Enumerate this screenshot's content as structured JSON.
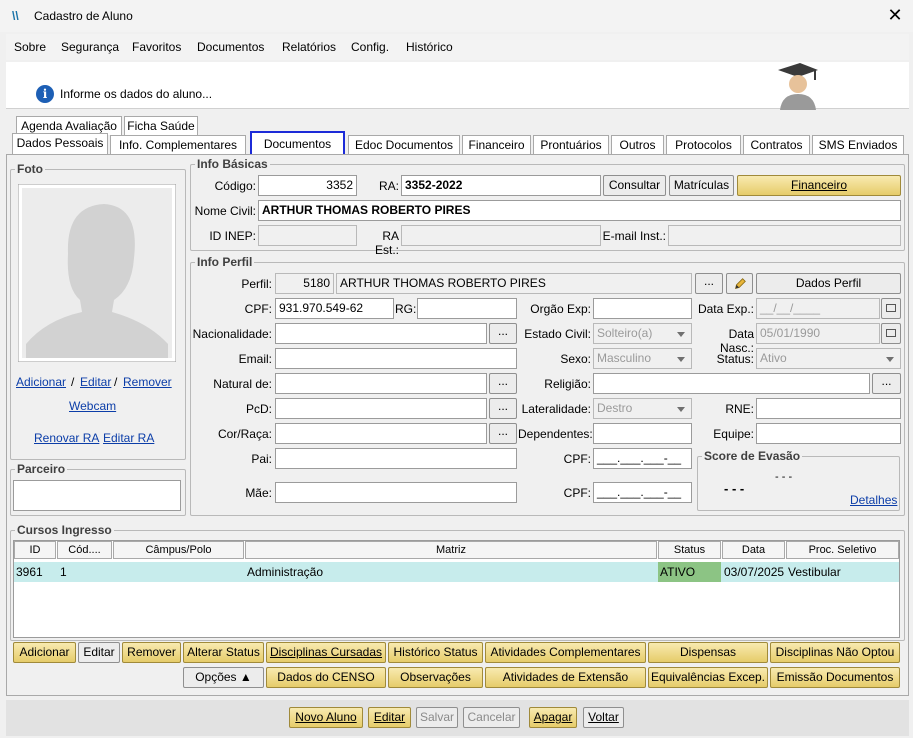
{
  "window": {
    "logo": "\\\\",
    "title": "Cadastro de Aluno",
    "close": "✕"
  },
  "menu": [
    "Sobre",
    "Segurança",
    "Favoritos",
    "Documentos",
    "Relatórios",
    "Config.",
    "Histórico"
  ],
  "info": {
    "text": "Informe os dados do aluno..."
  },
  "tabs_row1": [
    "Agenda Avaliação",
    "Ficha Saúde"
  ],
  "tabs_row2": [
    "Dados Pessoais",
    "Info. Complementares",
    "Documentos",
    "Edoc Documentos",
    "Financeiro",
    "Prontuários",
    "Outros",
    "Protocolos",
    "Contratos",
    "SMS Enviados"
  ],
  "foto": {
    "legend": "Foto",
    "adicionar": "Adicionar",
    "sep": "/",
    "editar": "Editar",
    "remover": "Remover",
    "webcam": "Webcam",
    "renovar_ra": "Renovar RA",
    "editar_ra": "Editar RA"
  },
  "parceiro": {
    "legend": "Parceiro"
  },
  "info_basicas": {
    "legend": "Info Básicas",
    "codigo_label": "Código:",
    "codigo": "3352",
    "ra_label": "RA:",
    "ra": "3352-2022",
    "consultar": "Consultar",
    "matriculas": "Matrículas",
    "financeiro": "Financeiro",
    "nome_label": "Nome Civil:",
    "nome": "ARTHUR THOMAS ROBERTO PIRES",
    "inep_label": "ID INEP:",
    "ra_est_label": "RA Est.:",
    "email_inst_label": "E-mail Inst.:"
  },
  "info_perfil": {
    "legend": "Info Perfil",
    "perfil_label": "Perfil:",
    "perfil_id": "5180",
    "perfil_nome": "ARTHUR THOMAS ROBERTO PIRES",
    "dots": "...",
    "dados_perfil": "Dados Perfil",
    "cpf_label": "CPF:",
    "cpf": "931.970.549-62",
    "rg_label": "RG:",
    "orgao_label": "Orgão Exp:",
    "data_exp_label": "Data Exp.:",
    "data_exp": "__/__/____",
    "nacionalidade_label": "Nacionalidade:",
    "estado_civil_label": "Estado Civil:",
    "estado_civil": "Solteiro(a)",
    "data_nasc_label": "Data Nasc.:",
    "data_nasc": "05/01/1990",
    "email_label": "Email:",
    "sexo_label": "Sexo:",
    "sexo": "Masculino",
    "status_label": "Status:",
    "status": "Ativo",
    "natural_label": "Natural de:",
    "religiao_label": "Religião:",
    "pcd_label": "PcD:",
    "lateralidade_label": "Lateralidade:",
    "lateralidade": "Destro",
    "rne_label": "RNE:",
    "cor_label": "Cor/Raça:",
    "dependentes_label": "Dependentes:",
    "equipe_label": "Equipe:",
    "pai_label": "Pai:",
    "cpf_pai_label": "CPF:",
    "cpf_mask": "___.___.___-__",
    "mae_label": "Mãe:",
    "cpf_mae_label": "CPF:"
  },
  "score": {
    "legend": "Score de Evasão",
    "value1": "- - -",
    "value2": "- - -",
    "detalhes": "Detalhes"
  },
  "cursos": {
    "legend": "Cursos Ingresso",
    "columns": [
      "ID",
      "Cód....",
      "Câmpus/Polo",
      "Matriz",
      "Status",
      "Data",
      "Proc. Seletivo"
    ],
    "rows": [
      [
        "3961",
        "1",
        "",
        "Administração",
        "ATIVO",
        "03/07/2025",
        "Vestibular"
      ]
    ],
    "status_color": "#8cc484"
  },
  "actions_row1": [
    "Adicionar",
    "Editar",
    "Remover",
    "Alterar Status",
    "Disciplinas Cursadas",
    "Histórico Status",
    "Atividades Complementares",
    "Dispensas",
    "Disciplinas Não Optou"
  ],
  "actions_row2": [
    "Opções ▲",
    "Dados do CENSO",
    "Observações",
    "Atividades de Extensão",
    "Equivalências Excep.",
    "Emissão Documentos"
  ],
  "footer": [
    "Novo Aluno",
    "Editar",
    "Salvar",
    "Cancelar",
    "Apagar",
    "Voltar"
  ]
}
